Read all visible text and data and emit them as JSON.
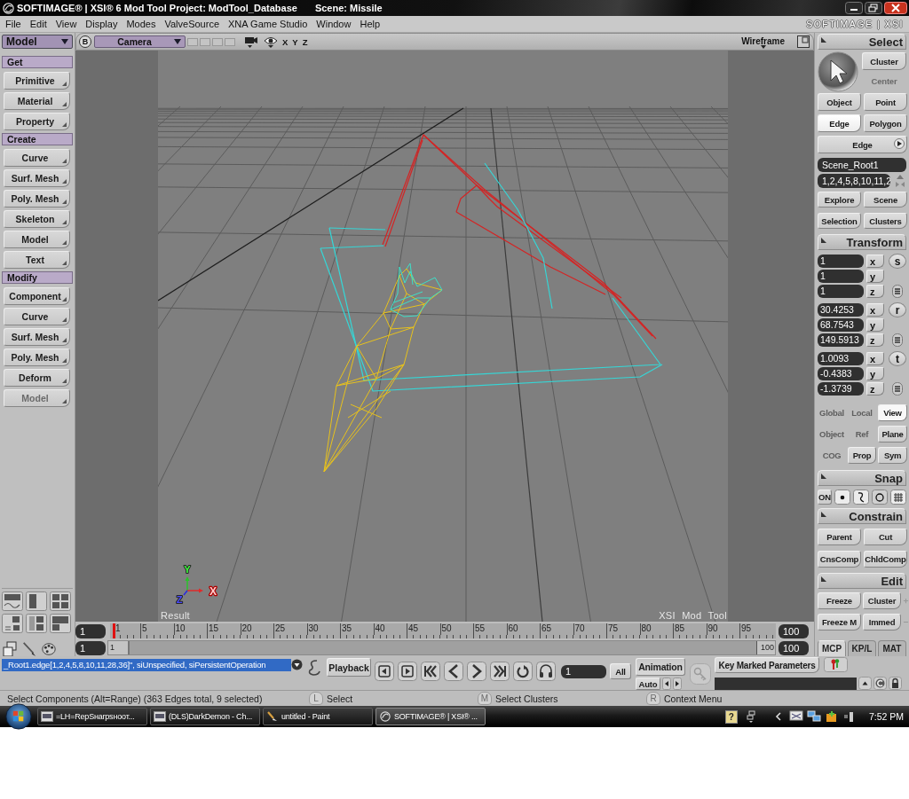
{
  "window": {
    "title": "SOFTIMAGE® | XSI® 6 Mod Tool Project: ModTool_Database",
    "scene": "Scene: Missile"
  },
  "menu": [
    "File",
    "Edit",
    "View",
    "Display",
    "Modes",
    "ValveSource",
    "XNA Game Studio",
    "Window",
    "Help"
  ],
  "brand": "SOFTIMAGE | XSI",
  "left_panel": {
    "mode": "Model",
    "sections": [
      {
        "title": "Get",
        "buttons": [
          {
            "label": "Primitive",
            "disabled": false
          },
          {
            "label": "Material",
            "disabled": false
          },
          {
            "label": "Property",
            "disabled": false
          }
        ]
      },
      {
        "title": "Create",
        "buttons": [
          {
            "label": "Curve",
            "disabled": false
          },
          {
            "label": "Surf. Mesh",
            "disabled": false
          },
          {
            "label": "Poly. Mesh",
            "disabled": false
          },
          {
            "label": "Skeleton",
            "disabled": false
          },
          {
            "label": "Model",
            "disabled": false
          },
          {
            "label": "Text",
            "disabled": false
          }
        ]
      },
      {
        "title": "Modify",
        "buttons": [
          {
            "label": "Component",
            "disabled": false
          },
          {
            "label": "Curve",
            "disabled": false
          },
          {
            "label": "Surf. Mesh",
            "disabled": false
          },
          {
            "label": "Poly. Mesh",
            "disabled": false
          },
          {
            "label": "Deform",
            "disabled": false
          },
          {
            "label": "Model",
            "disabled": true
          }
        ]
      }
    ]
  },
  "viewport": {
    "view_button": "B",
    "camera": "Camera",
    "axis_toggles": [
      "X",
      "Y",
      "Z"
    ],
    "display_mode": "Wireframe",
    "gizmo_labels": [
      "Y",
      "X",
      "Z"
    ],
    "caption_left": "Result",
    "caption_right": "XSI Mod Tool"
  },
  "timeline": {
    "start": "1",
    "range_start": "1",
    "ticks": [
      "1",
      "5",
      "10",
      "15",
      "20",
      "25",
      "30",
      "35",
      "40",
      "45",
      "50",
      "55",
      "60",
      "65",
      "70",
      "75",
      "80",
      "85",
      "90",
      "95"
    ],
    "range_handle_start": "1",
    "range_handle_end": "100",
    "end": "100",
    "range_end": "100"
  },
  "select": {
    "title": "Select",
    "tools": [
      {
        "label": "Cluster",
        "disabled": false
      },
      {
        "label": "Center",
        "disabled": true
      }
    ],
    "filters": [
      {
        "label": "Object",
        "selected": false
      },
      {
        "label": "Point",
        "selected": false
      },
      {
        "label": "Edge",
        "selected": true
      },
      {
        "label": "Polygon",
        "selected": false
      }
    ],
    "filter_menu": "Edge",
    "scene_field": "Scene_Root1",
    "selection_field": "1,2,4,5,8,10,11,2",
    "actions": [
      "Explore",
      "Scene",
      "Selection",
      "Clusters"
    ]
  },
  "transform": {
    "title": "Transform",
    "groups": [
      {
        "key": "s",
        "values": [
          {
            "axis": "x",
            "value": "1"
          },
          {
            "axis": "y",
            "value": "1"
          },
          {
            "axis": "z",
            "value": "1"
          }
        ]
      },
      {
        "key": "r",
        "values": [
          {
            "axis": "x",
            "value": "30.4253"
          },
          {
            "axis": "y",
            "value": "68.7543"
          },
          {
            "axis": "z",
            "value": "149.5913"
          }
        ]
      },
      {
        "key": "t",
        "values": [
          {
            "axis": "x",
            "value": "1.0093"
          },
          {
            "axis": "y",
            "value": "-0.4383"
          },
          {
            "axis": "z",
            "value": "-1.3739"
          }
        ]
      }
    ],
    "options": [
      [
        {
          "label": "Global",
          "disabled": true,
          "selected": false
        },
        {
          "label": "Local",
          "disabled": true,
          "selected": false
        },
        {
          "label": "View",
          "disabled": false,
          "selected": true
        }
      ],
      [
        {
          "label": "Object",
          "disabled": true,
          "selected": false
        },
        {
          "label": "Ref",
          "disabled": true,
          "selected": false
        },
        {
          "label": "Plane",
          "disabled": false,
          "selected": false
        }
      ],
      [
        {
          "label": "COG",
          "disabled": true,
          "selected": false
        },
        {
          "label": "Prop",
          "disabled": false,
          "selected": false
        },
        {
          "label": "Sym",
          "disabled": false,
          "selected": false
        }
      ]
    ]
  },
  "snap": {
    "title": "Snap",
    "on": "ON"
  },
  "constrain": {
    "title": "Constrain",
    "buttons": [
      "Parent",
      "Cut",
      "CnsComp",
      "ChldComp"
    ]
  },
  "edit": {
    "title": "Edit",
    "buttons": [
      "Freeze",
      "Cluster",
      "Freeze M",
      "Immed"
    ]
  },
  "panel_tabs": [
    {
      "label": "MCP",
      "selected": true
    },
    {
      "label": "KP/L",
      "selected": false
    },
    {
      "label": "MAT",
      "selected": false
    }
  ],
  "command_line": {
    "text": "_Root1.edge[1,2,4,5,8,10,11,28,36]\", siUnspecified, siPersistentOperation",
    "highlighted": true
  },
  "playback": {
    "label": "Playback",
    "frame": "1",
    "all": "All",
    "animation": "Animation",
    "auto": "Auto",
    "key_marked": "Key Marked Parameters"
  },
  "status_bar": {
    "message": "Select Components (Alt=Range) (363 Edges total, 9 selected)",
    "mouse_hints": [
      {
        "button": "L",
        "action": "Select"
      },
      {
        "button": "M",
        "action": "Select Clusters"
      },
      {
        "button": "R",
        "action": "Context Menu"
      }
    ]
  },
  "taskbar": {
    "tasks": [
      {
        "label": "=LH=RepSнarpsнooт...",
        "kind": "chat",
        "active": false
      },
      {
        "label": "(DLS)DarkDemon - Ch...",
        "kind": "chat",
        "active": false
      },
      {
        "label": "untitled - Paint",
        "kind": "paint",
        "active": false
      },
      {
        "label": "SOFTIMAGE® | XSI® ...",
        "kind": "softimage",
        "active": true
      }
    ],
    "help": "?",
    "clock": "7:52 PM"
  }
}
